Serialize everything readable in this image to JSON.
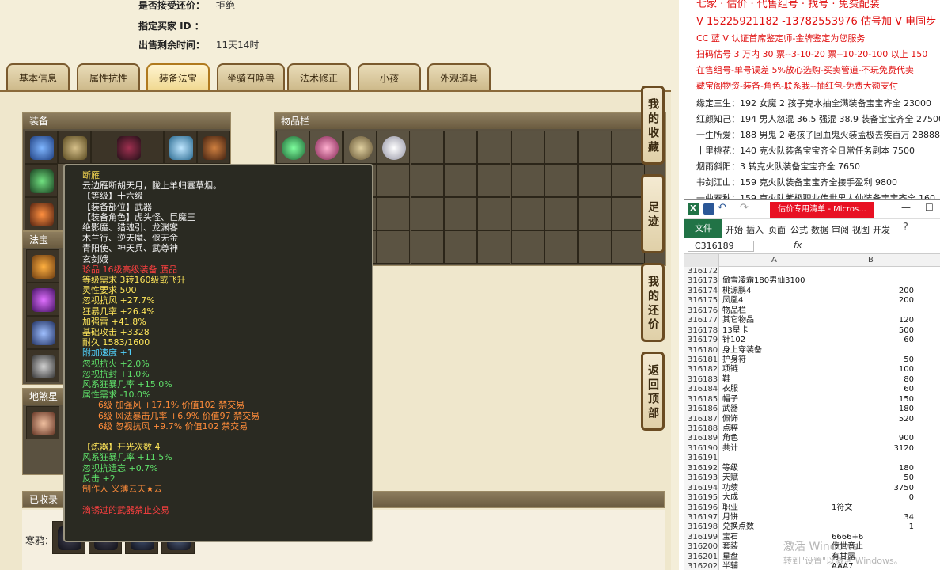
{
  "header_info": {
    "accept_counter_label": "是否接受还价：",
    "accept_counter_value": "拒绝",
    "buyer_label": "指定买家 ID ：",
    "buyer_value": "",
    "time_left_label": "出售剩余时间：",
    "time_left_value": "11天14时"
  },
  "tabs": [
    "基本信息",
    "属性抗性",
    "装备法宝",
    "坐骑召唤兽",
    "法术修正",
    "小孩",
    "外观道具"
  ],
  "active_tab": "装备法宝",
  "sections": {
    "equipment": "装备",
    "inventory": "物品栏",
    "fabao": "法宝",
    "ground_fabao": "地煞星",
    "collected": "已收录",
    "row_label": "寒鸦："
  },
  "side_buttons": [
    "我的收藏",
    "足迹",
    "我的还价",
    "返回顶部"
  ],
  "tooltip": {
    "lines": [
      {
        "text": "断雁",
        "color": "gold",
        "indent": 0
      },
      {
        "text": "云边雁断胡天月，陇上羊归塞草烟。",
        "color": "white",
        "indent": 0
      },
      {
        "text": "【等级】十六级",
        "color": "white",
        "indent": 0
      },
      {
        "text": "【装备部位】武器",
        "color": "white",
        "indent": 0
      },
      {
        "text": "【装备角色】虎头怪、巨魔王",
        "color": "white",
        "indent": 0
      },
      {
        "text": "绝影魔、猎魂引、龙渊客",
        "color": "white",
        "indent": 0
      },
      {
        "text": "木兰行、逆天魔、偃无金",
        "color": "white",
        "indent": 0
      },
      {
        "text": "青阳使、神天兵、武尊神",
        "color": "white",
        "indent": 0
      },
      {
        "text": "玄剑娥",
        "color": "white",
        "indent": 0
      },
      {
        "text": "珍品 16级高级装备 赝品",
        "color": "red",
        "indent": 0
      },
      {
        "text": "等级需求 3转160级或飞升",
        "color": "yellow",
        "indent": 0
      },
      {
        "text": "灵性要求 500",
        "color": "yellow",
        "indent": 0
      },
      {
        "text": "忽视抗风 +27.7%",
        "color": "yellow",
        "indent": 0
      },
      {
        "text": "狂暴几率 +26.4%",
        "color": "yellow",
        "indent": 0
      },
      {
        "text": "加强雷 +41.8%",
        "color": "yellow",
        "indent": 0
      },
      {
        "text": "基础攻击 +3328",
        "color": "yellow",
        "indent": 0
      },
      {
        "text": "耐久 1583/1600",
        "color": "yellow",
        "indent": 0
      },
      {
        "text": "附加速度 +1",
        "color": "cyan",
        "indent": 0
      },
      {
        "text": "忽视抗火 +2.0%",
        "color": "green",
        "indent": 0
      },
      {
        "text": "忽视抗封 +1.0%",
        "color": "green",
        "indent": 0
      },
      {
        "text": "风系狂暴几率 +15.0%",
        "color": "green",
        "indent": 0
      },
      {
        "text": "属性需求 -10.0%",
        "color": "green",
        "indent": 0
      },
      {
        "text": "6级 加强风 +17.1% 价值102 禁交易",
        "color": "orange",
        "indent": 1
      },
      {
        "text": "6级 风法暴击几率 +6.9% 价值97 禁交易",
        "color": "orange",
        "indent": 1
      },
      {
        "text": "6级 忽视抗风 +9.7% 价值102 禁交易",
        "color": "orange",
        "indent": 1
      },
      {
        "text": "",
        "color": "white",
        "indent": 0
      },
      {
        "text": "【炼器】开光次数 4",
        "color": "yellow",
        "indent": 0
      },
      {
        "text": "风系狂暴几率 +11.5%",
        "color": "green",
        "indent": 0
      },
      {
        "text": "忽视抗遗忘 +0.7%",
        "color": "green",
        "indent": 0
      },
      {
        "text": "反击 +2",
        "color": "green",
        "indent": 0
      },
      {
        "text": "制作人 义薄云天★云",
        "color": "orange",
        "indent": 0
      },
      {
        "text": "",
        "color": "white",
        "indent": 0
      },
      {
        "text": "滴锈过的武器禁止交易",
        "color": "red",
        "indent": 0
      }
    ]
  },
  "right_promo": {
    "red_lines": [
      "V 15225921182 -13782553976 估号加 V 电同步",
      "CC 蓝 V 认证首席鉴定师-金牌鉴定为您服务",
      "扫码估号 3 万内 30 票--3-10-20 票--10-20-100 以上 150",
      "在售组号-单号误差 5%放心选购-买卖管道-不玩免费代卖",
      "藏宝阁物资-装备-角色-联系我--抽红包-免费大额支付"
    ],
    "dark_lines": [
      "缘定三生：192 女魔 2 孩子克水抽全满装备宝宝齐全 23000",
      "红颜知己：194 男人忽混 36.5 强混 38.9 装备宝宝齐全 27500",
      "一生所爱：188 男鬼 2 老孩子回血鬼火装孟极去疾百万 28888",
      "十里桃花：140 克火队装备宝宝齐全日常任务副本 7500",
      "烟雨斜阳：3 转克火队装备宝宝齐全 7650",
      "书剑江山：159 克火队装备宝宝齐全接手盈利 9800",
      "一曲春秋：159 克火队紫极职业传世男人仙装备宝宝齐全 160"
    ]
  },
  "excel": {
    "title_tab": "估价专用清单 - Micros...",
    "ribbon": [
      "文件",
      "开始",
      "插入",
      "页面",
      "公式",
      "数据",
      "审阅",
      "视图",
      "开发"
    ],
    "name_box": "C316189",
    "fx": "fx",
    "col_a": "A",
    "col_b": "B",
    "rows": [
      {
        "n": "316172",
        "a": "",
        "b": ""
      },
      {
        "n": "316173",
        "a": "傲雪凌霜180男仙3100",
        "b": ""
      },
      {
        "n": "316174",
        "a": "桃源鹏4",
        "b": "200"
      },
      {
        "n": "316175",
        "a": "凤凰4",
        "b": "200"
      },
      {
        "n": "316176",
        "a": "物品栏",
        "b": ""
      },
      {
        "n": "316177",
        "a": "其它物品",
        "b": "120"
      },
      {
        "n": "316178",
        "a": "13星卡",
        "b": "500"
      },
      {
        "n": "316179",
        "a": "针102",
        "b": "60"
      },
      {
        "n": "316180",
        "a": "身上穿装备",
        "b": ""
      },
      {
        "n": "316181",
        "a": "护身符",
        "b": "50"
      },
      {
        "n": "316182",
        "a": "项链",
        "b": "100"
      },
      {
        "n": "316183",
        "a": "鞋",
        "b": "80"
      },
      {
        "n": "316184",
        "a": "衣服",
        "b": "60"
      },
      {
        "n": "316185",
        "a": "帽子",
        "b": "150"
      },
      {
        "n": "316186",
        "a": "武器",
        "b": "180"
      },
      {
        "n": "316187",
        "a": "佩饰",
        "b": "520"
      },
      {
        "n": "316188",
        "a": "点粹",
        "b": ""
      },
      {
        "n": "316189",
        "a": "角色",
        "b": "900"
      },
      {
        "n": "316190",
        "a": "共计",
        "b": "3120"
      },
      {
        "n": "316191",
        "a": "",
        "b": ""
      },
      {
        "n": "316192",
        "a": "等级",
        "b": "180"
      },
      {
        "n": "316193",
        "a": "天赋",
        "b": "50"
      },
      {
        "n": "316194",
        "a": "功绩",
        "b": "3750"
      },
      {
        "n": "316195",
        "a": "大成",
        "b": "0"
      },
      {
        "n": "316196",
        "a": "职业",
        "bl": "1符文"
      },
      {
        "n": "316197",
        "a": "月饼",
        "b": "34"
      },
      {
        "n": "316198",
        "a": "兑换点数",
        "b": "1"
      },
      {
        "n": "316199",
        "a": "宝石",
        "bl": "6666+6"
      },
      {
        "n": "316200",
        "a": "套装",
        "bl": "传世音止"
      },
      {
        "n": "316201",
        "a": "星盘",
        "bl": "有甘露"
      },
      {
        "n": "316202",
        "a": "半辅",
        "bl": "AAA7"
      }
    ]
  },
  "watermark": [
    "激活 Windows",
    "转到\"设置\"以激活 Windows。"
  ],
  "colors": {
    "tooltip_bg": "#2a2a22",
    "panel_bg": "#efe7cc",
    "slot_bg": "#5b5342",
    "promo_red": "#e01010",
    "excel_green": "#217346"
  }
}
